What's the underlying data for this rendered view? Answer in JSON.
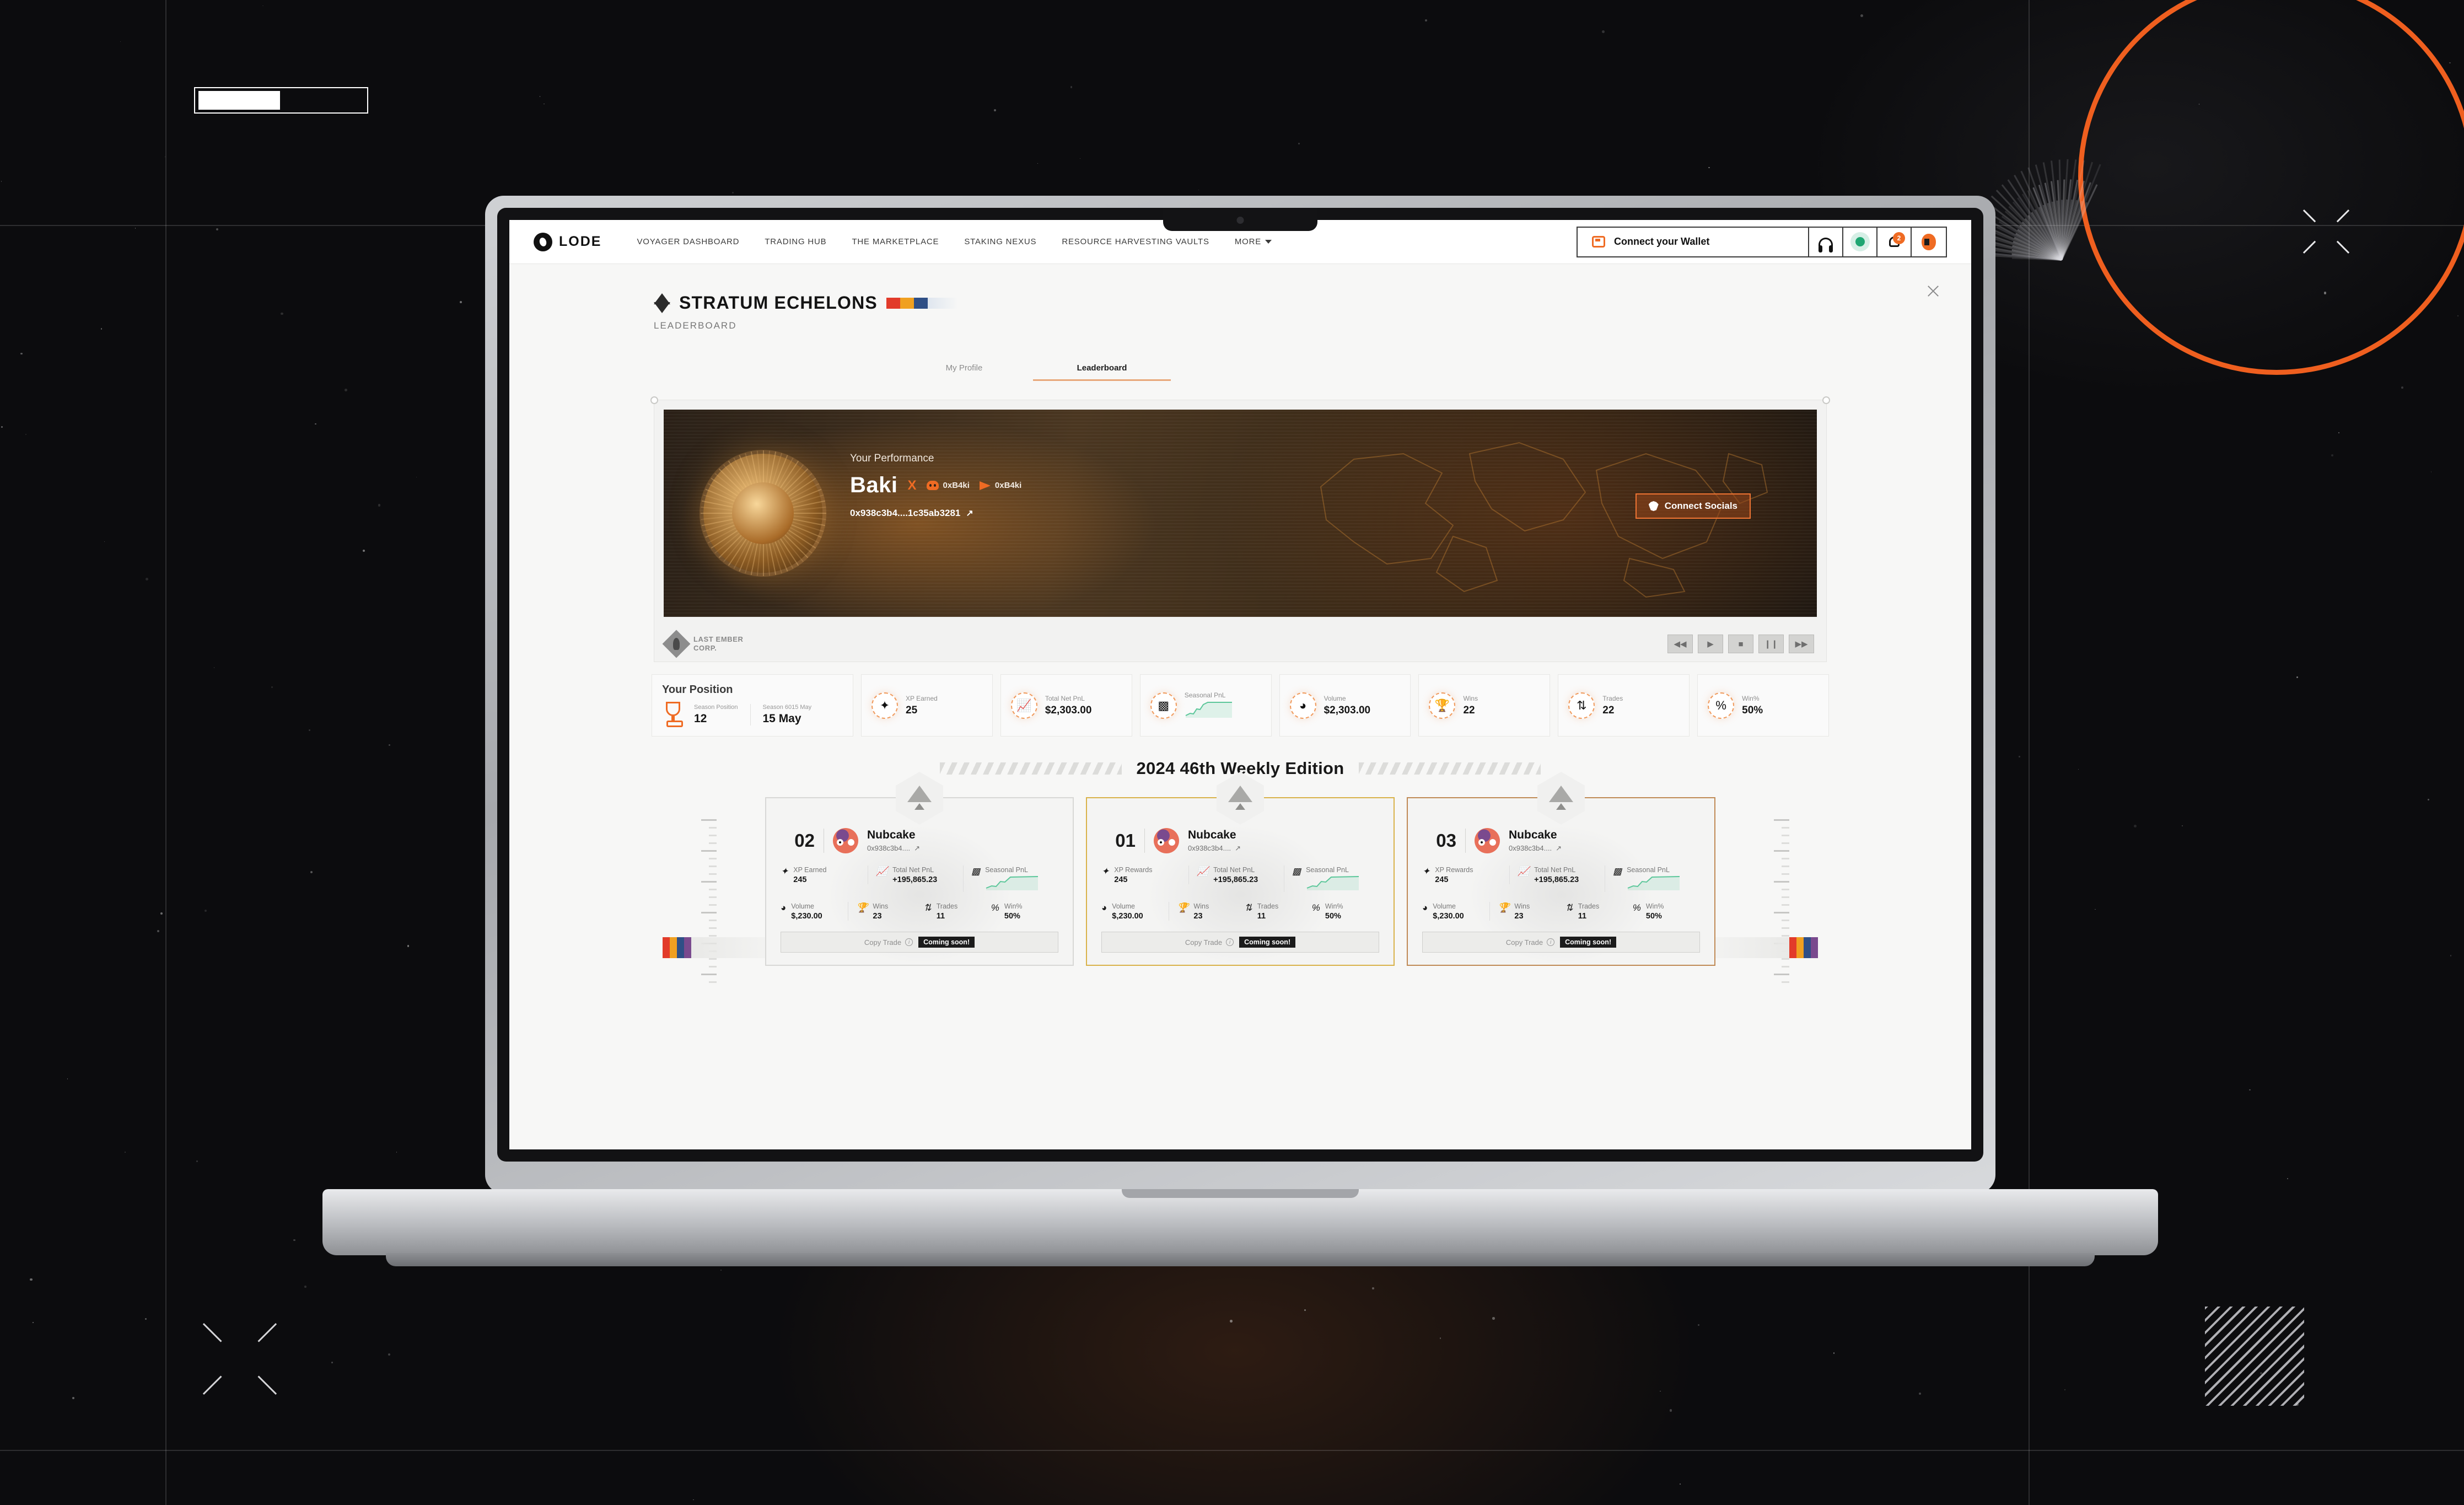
{
  "nav": {
    "brand": "LODE",
    "links": [
      {
        "label": "VOYAGER DASHBOARD"
      },
      {
        "label": "TRADING HUB"
      },
      {
        "label": "THE MARKETPLACE"
      },
      {
        "label": "STAKING NEXUS"
      },
      {
        "label": "RESOURCE HARVESTING VAULTS"
      },
      {
        "label": "MORE"
      }
    ],
    "wallet_label": "Connect your Wallet",
    "notification_count": "2",
    "icons": [
      "wallet-icon",
      "headset-icon",
      "status-dot-icon",
      "bell-icon",
      "avatar-icon"
    ]
  },
  "header": {
    "title": "STRATUM ECHELONS",
    "subtitle": "LEADERBOARD",
    "flag_colors": [
      "#e23b2a",
      "#f0a020",
      "#2f4f86",
      "#dfe6ef"
    ]
  },
  "tabs": [
    {
      "label": "My Profile",
      "active": false
    },
    {
      "label": "Leaderboard",
      "active": true
    }
  ],
  "hero": {
    "eyebrow": "Your Performance",
    "name": "Baki",
    "x_handle": "X",
    "discord": "0xB4ki",
    "telegram": "0xB4ki",
    "address": "0x938c3b4....1c35ab3281",
    "connect_socials": "Connect Socials",
    "studio_line1": "LAST EMBER",
    "studio_line2": "CORP.",
    "media_buttons": [
      "rewind-button",
      "play-button",
      "stop-button",
      "pause-button",
      "fast-forward-button"
    ]
  },
  "your_position": {
    "title": "Your Position",
    "season_position_label": "Season Position",
    "season_position_value": "12",
    "season_date_label": "Season 6015 May",
    "season_date_value": "15 May"
  },
  "stats": [
    {
      "label": "XP Earned",
      "value": "25",
      "icon": "sparkle-icon"
    },
    {
      "label": "Total Net PnL",
      "value": "$2,303.00",
      "icon": "trend-up-icon"
    },
    {
      "label": "Seasonal PnL",
      "value": "",
      "icon": "bar-chart-icon",
      "sparkline": true
    },
    {
      "label": "Volume",
      "value": "$2,303.00",
      "icon": "pie-chart-icon"
    },
    {
      "label": "Wins",
      "value": "22",
      "icon": "trophy-icon"
    },
    {
      "label": "Trades",
      "value": "22",
      "icon": "swap-arrows-icon"
    },
    {
      "label": "Win%",
      "value": "50%",
      "icon": "percent-icon"
    }
  ],
  "weekly": {
    "title": "2024 46th Weekly Edition"
  },
  "podium": [
    {
      "rank": "02",
      "name": "Nubcake",
      "address": "0x938c3b4....",
      "tier": "silver",
      "metrics": {
        "xp_label": "XP Earned",
        "xp_value": "245",
        "pnl_label": "Total Net PnL",
        "pnl_value": "+195,865.23",
        "seasonal_label": "Seasonal PnL",
        "volume_label": "Volume",
        "volume_value": "$,230.00",
        "wins_label": "Wins",
        "wins_value": "23",
        "trades_label": "Trades",
        "trades_value": "11",
        "winrate_label": "Win%",
        "winrate_value": "50%"
      },
      "copy_trade_label": "Copy Trade",
      "coming_soon_label": "Coming soon!"
    },
    {
      "rank": "01",
      "name": "Nubcake",
      "address": "0x938c3b4....",
      "tier": "gold",
      "metrics": {
        "xp_label": "XP Rewards",
        "xp_value": "245",
        "pnl_label": "Total Net PnL",
        "pnl_value": "+195,865.23",
        "seasonal_label": "Seasonal PnL",
        "volume_label": "Volume",
        "volume_value": "$,230.00",
        "wins_label": "Wins",
        "wins_value": "23",
        "trades_label": "Trades",
        "trades_value": "11",
        "winrate_label": "Win%",
        "winrate_value": "50%"
      },
      "copy_trade_label": "Copy Trade",
      "coming_soon_label": "Coming soon!"
    },
    {
      "rank": "03",
      "name": "Nubcake",
      "address": "0x938c3b4....",
      "tier": "bronze",
      "metrics": {
        "xp_label": "XP Rewards",
        "xp_value": "245",
        "pnl_label": "Total Net PnL",
        "pnl_value": "+195,865.23",
        "seasonal_label": "Seasonal PnL",
        "volume_label": "Volume",
        "volume_value": "$,230.00",
        "wins_label": "Wins",
        "wins_value": "23",
        "trades_label": "Trades",
        "trades_value": "11",
        "winrate_label": "Win%",
        "winrate_value": "50%"
      },
      "copy_trade_label": "Copy Trade",
      "coming_soon_label": "Coming soon!"
    }
  ],
  "colors": {
    "accent": "#ef6b23",
    "gold": "#d9b24a",
    "bronze": "#c08a56",
    "green": "#5cc79a",
    "dark_bg": "#0c0c0e"
  }
}
